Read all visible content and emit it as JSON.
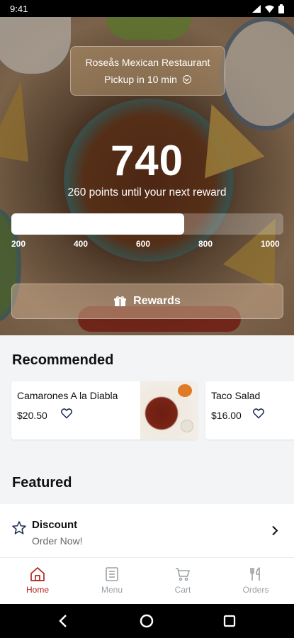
{
  "status_bar": {
    "time": "9:41"
  },
  "restaurant": {
    "name": "Roseås Mexican Restaurant",
    "pickup": "Pickup in 10 min"
  },
  "rewards": {
    "points": "740",
    "subtitle": "260 points until your next reward",
    "progress_fraction": 0.635,
    "ticks": [
      "200",
      "400",
      "600",
      "800",
      "1000"
    ],
    "button_label": "Rewards"
  },
  "recommended": {
    "title": "Recommended",
    "items": [
      {
        "name": "Camarones A la Diabla",
        "price": "$20.50"
      },
      {
        "name": "Taco Salad",
        "price": "$16.00"
      }
    ]
  },
  "featured": {
    "title": "Featured",
    "items": [
      {
        "title": "Discount",
        "subtitle": "Order Now!"
      }
    ]
  },
  "nav": {
    "items": [
      {
        "label": "Home",
        "icon": "home-icon",
        "active": true
      },
      {
        "label": "Menu",
        "icon": "menu-icon",
        "active": false
      },
      {
        "label": "Cart",
        "icon": "cart-icon",
        "active": false
      },
      {
        "label": "Orders",
        "icon": "utensils-icon",
        "active": false
      }
    ]
  },
  "colors": {
    "accent": "#b3261e",
    "inactive": "#9aa0a6"
  }
}
